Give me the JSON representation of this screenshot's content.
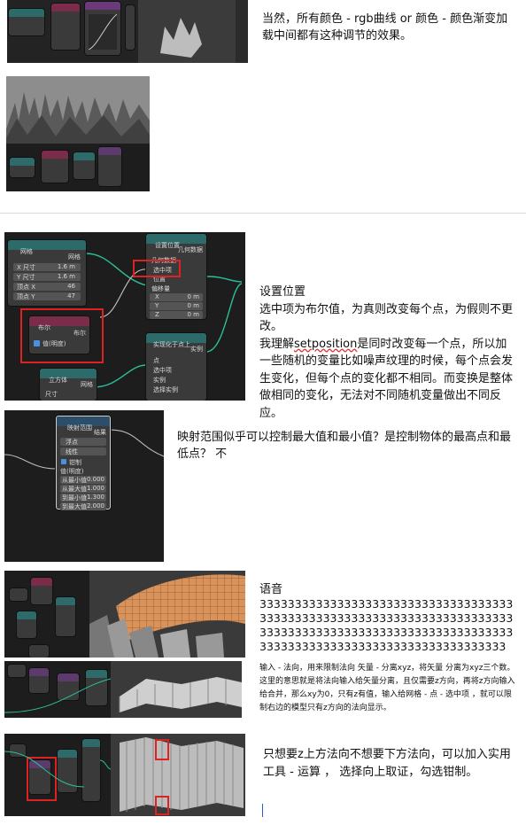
{
  "notes": {
    "note1": "当然，所有颜色 - rgb曲线 or 颜色 - 颜色渐变加载中间都有这种调节的效果。",
    "note2_title": "设置位置",
    "note2_line1": "选中项为布尔值，为真则改变每个点，为假则不更改。",
    "note2_line2_pre": "我理解",
    "note2_line2_ul": "setposition",
    "note2_line2_post": "是同时改变每一个点，所以加一些随机的变量比如噪声纹理的时候，每个点会发生变化，但每个点的变化都不相同。而变换是整体做相同的变化，无法对不同随机变量做出不同反应。",
    "note3": "映射范围似乎可以控制最大值和最小值？是控制物体的最高点和最低点？ 不",
    "note4_title": "语音",
    "note4_body": "33333333333333333333333333333333333333333333333333333333333333333333333333333333333333333333333333333333333333333333333333333333333333333333333",
    "note5": "输入 - 法向，用来限制法向  矢量 - 分离xyz，将矢量 分离为xyz三个数。这里的意思就是将法向输入给矢量分离，且仅需要z方向，再将z方向输入给合并，那么xy为0，只有z有值，输入给网格 - 点 - 选中项 ，就可以限制右边的模型只有z方向的法向显示。",
    "note6": "只想要z上方法向不想要下方法向，可以加入实用工具 - 运算 ， 选择向上取证，勾选钳制。"
  },
  "shot2": {
    "node_grid": "网格",
    "grid_out": "网格",
    "size_x_label": "X 尺寸",
    "size_x_val": "1.6 m",
    "size_y_label": "Y 尺寸",
    "size_y_val": "1.6 m",
    "verts_x_label": "顶点 X",
    "verts_x_val": "46",
    "verts_y_label": "顶点 Y",
    "verts_y_val": "47",
    "node_setpos": "设置位置",
    "geo_out": "几何数据",
    "geo_in": "几何数据",
    "selection": "选中项",
    "position": "位置",
    "offset": "偏移量",
    "x": "X",
    "x_val": "0 m",
    "y": "Y",
    "y_val": "0 m",
    "z": "Z",
    "z_val": "0 m",
    "node_bool": "布尔",
    "bool_out": "布尔",
    "bool_check": "值(明度)",
    "node_realize": "实现化于点上",
    "inst": "实例",
    "point": "点",
    "sel2": "选中项",
    "inst2": "实例",
    "pick": "选择实例",
    "node_cube": "立方体",
    "mesh": "网格",
    "size": "尺寸"
  },
  "shot3": {
    "node": "映射范围",
    "result": "结果",
    "float": "浮点",
    "linear": "线性",
    "clamp": "钳制",
    "value": "值(明度)",
    "from_min": "从最小值",
    "from_min_v": "0.000",
    "from_max": "从最大值",
    "from_max_v": "1.000",
    "to_min": "到最小值",
    "to_min_v": "-1.300",
    "to_max": "到最大值",
    "to_max_v": "2.000"
  }
}
